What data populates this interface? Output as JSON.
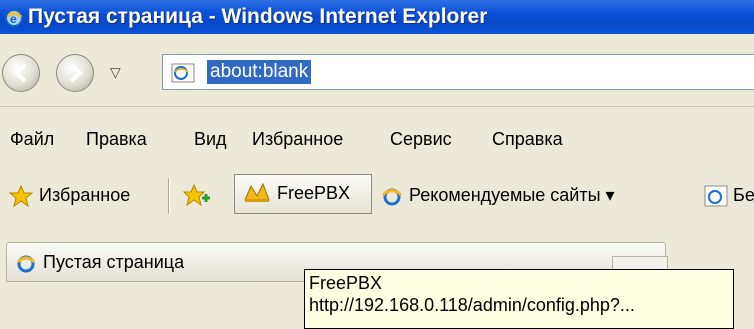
{
  "window": {
    "title": "Пустая страница - Windows Internet Explorer"
  },
  "address": {
    "url": "about:blank"
  },
  "menu": {
    "items": [
      "Файл",
      "Правка",
      "Вид",
      "Избранное",
      "Сервис",
      "Справка"
    ]
  },
  "favorites_bar": {
    "favorites_label": "Избранное",
    "freepbx_label": "FreePBX",
    "suggested_sites_label": "Рекомендуемые сайты ▾",
    "truncated_label": "Бе"
  },
  "tab": {
    "title": "Пустая страница"
  },
  "tooltip": {
    "line1": "FreePBX",
    "line2": "http://192.168.0.118/admin/config.php?..."
  }
}
